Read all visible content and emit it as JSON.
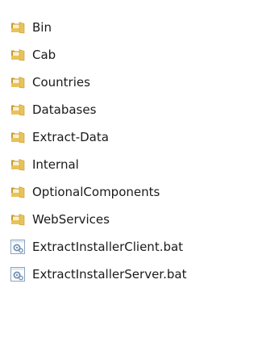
{
  "explorer": {
    "items": [
      {
        "label": "Bin",
        "icon": "folder-icon"
      },
      {
        "label": "Cab",
        "icon": "folder-icon"
      },
      {
        "label": "Countries",
        "icon": "folder-icon"
      },
      {
        "label": "Databases",
        "icon": "folder-icon"
      },
      {
        "label": "Extract-Data",
        "icon": "folder-icon"
      },
      {
        "label": "Internal",
        "icon": "folder-icon"
      },
      {
        "label": "OptionalComponents",
        "icon": "folder-icon"
      },
      {
        "label": "WebServices",
        "icon": "folder-icon"
      },
      {
        "label": "ExtractInstallerClient.bat",
        "icon": "batch-file-icon"
      },
      {
        "label": "ExtractInstallerServer.bat",
        "icon": "batch-file-icon"
      }
    ]
  },
  "colors": {
    "folder_front": "#e8c25a",
    "folder_back": "#c99a2e",
    "folder_paper": "#fbf1d0",
    "batch_border": "#8aa3bf",
    "batch_fill": "#ffffff"
  }
}
